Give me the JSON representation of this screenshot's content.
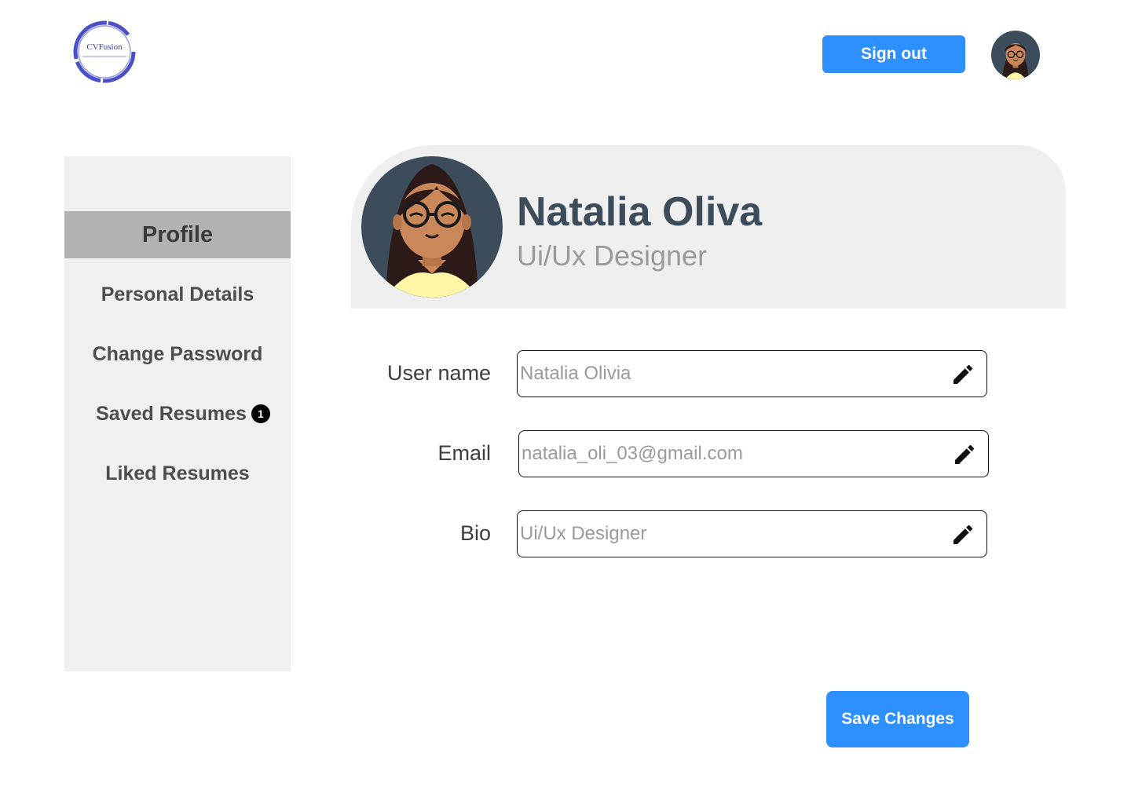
{
  "logo": {
    "text": "CVFusion",
    "ring_color": "#4b50c8"
  },
  "header": {
    "signout_label": "Sign out"
  },
  "sidebar": {
    "active": "Profile",
    "items": [
      {
        "label": "Personal Details"
      },
      {
        "label": "Change Password"
      },
      {
        "label": "Saved Resumes",
        "badge": "1"
      },
      {
        "label": "Liked Resumes"
      }
    ]
  },
  "profile": {
    "name": "Natalia Oliva",
    "role": "Ui/Ux Designer"
  },
  "form": {
    "username": {
      "label": "User name",
      "placeholder": "Natalia Olivia"
    },
    "email": {
      "label": "Email",
      "placeholder": "natalia_oli_03@gmail.com"
    },
    "bio": {
      "label": "Bio",
      "placeholder": "Ui/Ux Designer"
    }
  },
  "save_label": "Save Changes",
  "colors": {
    "accent": "#2e8fff",
    "sidebar_bg": "#f0f0f0",
    "active_bg": "#b5b1b1",
    "name": "#3c4c5a"
  },
  "icons": [
    "avatar",
    "edit-pencil-icon",
    "logo-ring"
  ]
}
